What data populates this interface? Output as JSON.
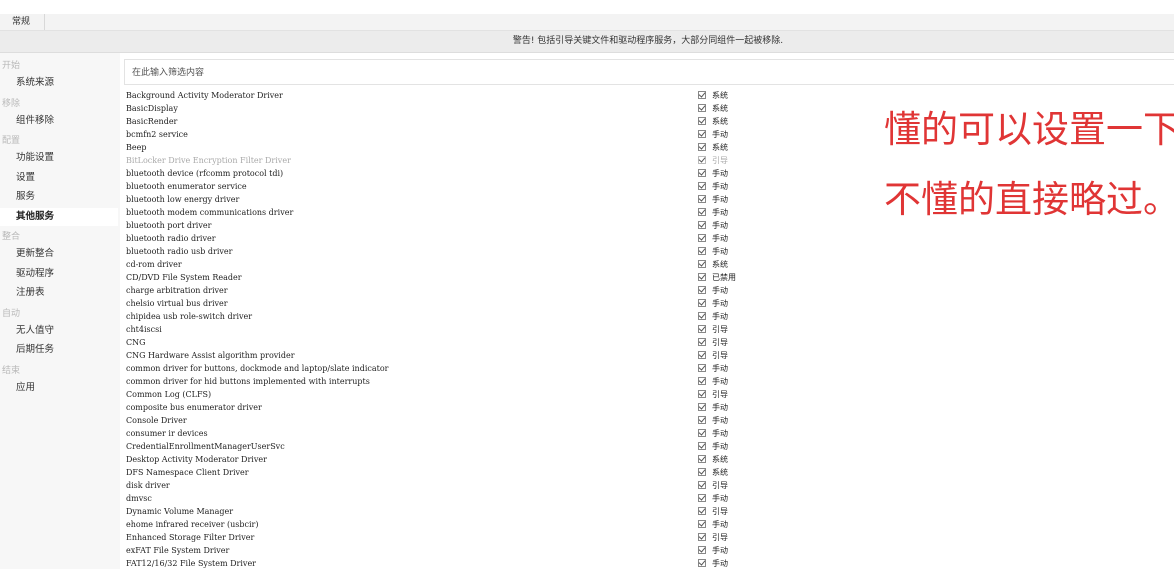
{
  "tabbar": {
    "tab_label": "常规"
  },
  "warning": "警告! 包括引导关键文件和驱动程序服务，大部分同组件一起被移除.",
  "sidebar": {
    "sections": [
      {
        "title": "开始",
        "items": [
          {
            "label": "系统来源"
          }
        ]
      },
      {
        "title": "移除",
        "items": [
          {
            "label": "组件移除"
          }
        ]
      },
      {
        "title": "配置",
        "items": [
          {
            "label": "功能设置"
          },
          {
            "label": "设置"
          },
          {
            "label": "服务"
          },
          {
            "label": "其他服务",
            "active": true
          }
        ]
      },
      {
        "title": "整合",
        "items": [
          {
            "label": "更新整合"
          },
          {
            "label": "驱动程序"
          },
          {
            "label": "注册表"
          }
        ]
      },
      {
        "title": "自动",
        "items": [
          {
            "label": "无人值守"
          },
          {
            "label": "后期任务"
          }
        ]
      },
      {
        "title": "结束",
        "items": [
          {
            "label": "应用"
          }
        ]
      }
    ]
  },
  "filter": {
    "placeholder": "在此输入筛选内容"
  },
  "services": [
    {
      "name": "Background Activity Moderator Driver",
      "status": "系统"
    },
    {
      "name": "BasicDisplay",
      "status": "系统"
    },
    {
      "name": "BasicRender",
      "status": "系统"
    },
    {
      "name": "bcmfn2 service",
      "status": "手动"
    },
    {
      "name": "Beep",
      "status": "系统"
    },
    {
      "name": "BitLocker Drive Encryption Filter Driver",
      "status": "引导",
      "disabled": true
    },
    {
      "name": "bluetooth device (rfcomm protocol tdi)",
      "status": "手动"
    },
    {
      "name": "bluetooth enumerator service",
      "status": "手动"
    },
    {
      "name": "bluetooth low energy driver",
      "status": "手动"
    },
    {
      "name": "bluetooth modem communications driver",
      "status": "手动"
    },
    {
      "name": "bluetooth port driver",
      "status": "手动"
    },
    {
      "name": "bluetooth radio driver",
      "status": "手动"
    },
    {
      "name": "bluetooth radio usb driver",
      "status": "手动"
    },
    {
      "name": "cd-rom driver",
      "status": "系统"
    },
    {
      "name": "CD/DVD File System Reader",
      "status": "已禁用"
    },
    {
      "name": "charge arbitration driver",
      "status": "手动"
    },
    {
      "name": "chelsio virtual bus driver",
      "status": "手动"
    },
    {
      "name": "chipidea usb role-switch driver",
      "status": "手动"
    },
    {
      "name": "cht4iscsi",
      "status": "引导"
    },
    {
      "name": "CNG",
      "status": "引导"
    },
    {
      "name": "CNG Hardware Assist algorithm provider",
      "status": "引导"
    },
    {
      "name": "common driver for buttons, dockmode and laptop/slate indicator",
      "status": "手动"
    },
    {
      "name": "common driver for hid buttons implemented with interrupts",
      "status": "手动"
    },
    {
      "name": "Common Log (CLFS)",
      "status": "引导"
    },
    {
      "name": "composite bus enumerator driver",
      "status": "手动"
    },
    {
      "name": "Console Driver",
      "status": "手动"
    },
    {
      "name": "consumer ir devices",
      "status": "手动"
    },
    {
      "name": "CredentialEnrollmentManagerUserSvc",
      "status": "手动"
    },
    {
      "name": "Desktop Activity Moderator Driver",
      "status": "系统"
    },
    {
      "name": "DFS Namespace Client Driver",
      "status": "系统"
    },
    {
      "name": "disk driver",
      "status": "引导"
    },
    {
      "name": "dmvsc",
      "status": "手动"
    },
    {
      "name": "Dynamic Volume Manager",
      "status": "引导"
    },
    {
      "name": "ehome infrared receiver (usbcir)",
      "status": "手动"
    },
    {
      "name": "Enhanced Storage Filter Driver",
      "status": "引导"
    },
    {
      "name": "exFAT File System Driver",
      "status": "手动"
    },
    {
      "name": "FAT12/16/32 File System Driver",
      "status": "手动"
    }
  ],
  "annotation": {
    "line1": "懂的可以设置一下",
    "line2": "不懂的直接略过。"
  },
  "colors": {
    "annotation": "#e03535",
    "sidebar_bg": "#f7f7f7",
    "warning_bg": "#ececec"
  },
  "icons": {
    "status_checkbox": "checkbox-checked-icon"
  }
}
